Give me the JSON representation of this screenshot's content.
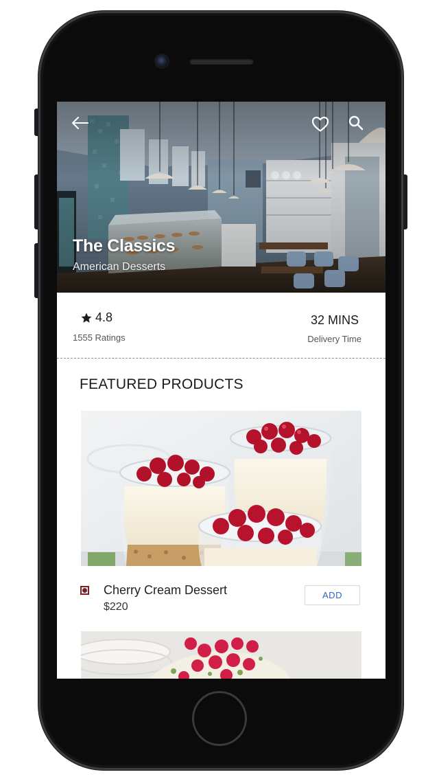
{
  "store": {
    "name": "The Classics",
    "cuisine": "American Desserts"
  },
  "header_icons": {
    "back": "arrow-left-icon",
    "favorite": "heart-icon",
    "search": "search-icon"
  },
  "info": {
    "rating": "4.8",
    "rating_label": "1555 Ratings",
    "delivery_time": "32 MINS",
    "delivery_label": "Delivery Time"
  },
  "featured": {
    "title": "FEATURED PRODUCTS",
    "products": [
      {
        "name": "Cherry Cream Dessert",
        "price": "$220",
        "add_label": "ADD"
      }
    ]
  },
  "colors": {
    "add_text": "#2b63c8",
    "diet_marker": "#7d1f27",
    "phone_body": "#0b0b0c"
  }
}
